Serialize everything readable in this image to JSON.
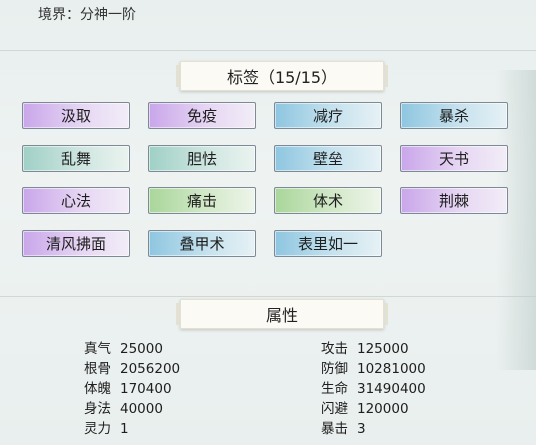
{
  "realm_label": "境界：分神一阶",
  "tags_header": "标签（15/15）",
  "tags": [
    {
      "label": "汲取",
      "color": "purple"
    },
    {
      "label": "免疫",
      "color": "purple"
    },
    {
      "label": "减疗",
      "color": "blue"
    },
    {
      "label": "暴杀",
      "color": "blue"
    },
    {
      "label": "乱舞",
      "color": "teal"
    },
    {
      "label": "胆怯",
      "color": "teal"
    },
    {
      "label": "壁垒",
      "color": "blue"
    },
    {
      "label": "天书",
      "color": "purple"
    },
    {
      "label": "心法",
      "color": "purple"
    },
    {
      "label": "痛击",
      "color": "green"
    },
    {
      "label": "体术",
      "color": "green"
    },
    {
      "label": "荆棘",
      "color": "purple"
    },
    {
      "label": "清风拂面",
      "color": "purple"
    },
    {
      "label": "叠甲术",
      "color": "blue"
    },
    {
      "label": "表里如一",
      "color": "blue"
    }
  ],
  "attributes_header": "属性",
  "stats_left": [
    {
      "label": "真气",
      "value": "25000"
    },
    {
      "label": "根骨",
      "value": "2056200"
    },
    {
      "label": "体魄",
      "value": "170400"
    },
    {
      "label": "身法",
      "value": "40000"
    },
    {
      "label": "灵力",
      "value": "1"
    }
  ],
  "stats_right": [
    {
      "label": "攻击",
      "value": "125000"
    },
    {
      "label": "防御",
      "value": "10281000"
    },
    {
      "label": "生命",
      "value": "31490400"
    },
    {
      "label": "闪避",
      "value": "120000"
    },
    {
      "label": "暴击",
      "value": "3"
    }
  ],
  "colors": {
    "purple": "#c9a6ea",
    "blue": "#8ec6e0",
    "teal": "#9fd0c6",
    "green": "#a9d69a"
  }
}
